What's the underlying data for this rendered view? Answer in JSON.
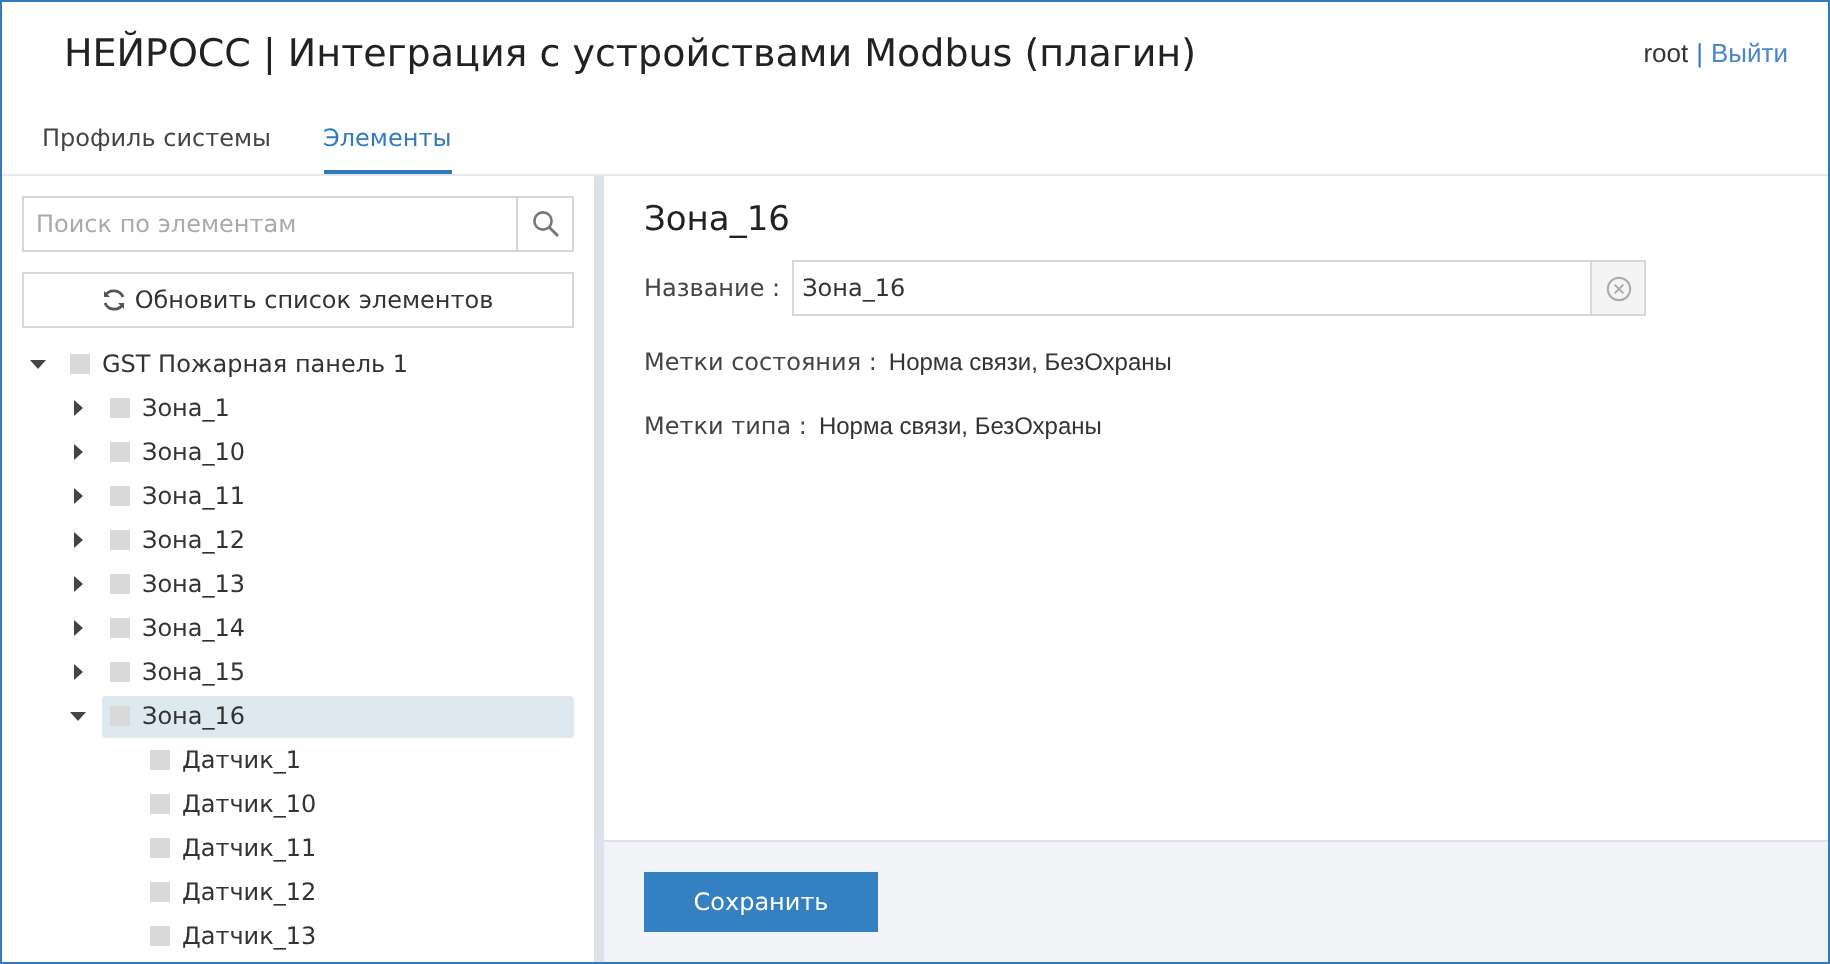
{
  "header": {
    "title": "НЕЙРОСС | Интеграция с устройствами Modbus (плагин)",
    "user": "root",
    "separator": "|",
    "logout": "Выйти"
  },
  "tabs": [
    {
      "label": "Профиль системы",
      "selected": false
    },
    {
      "label": "Элементы",
      "selected": true
    }
  ],
  "sidebar": {
    "search": {
      "placeholder": "Поиск по элементам"
    },
    "refresh_button": "Обновить список элементов",
    "tree": [
      {
        "label": "GST Пожарная панель 1",
        "expanded": true,
        "selected": false,
        "children": [
          {
            "label": "Зона_1",
            "expanded": false,
            "selected": false
          },
          {
            "label": "Зона_10",
            "expanded": false,
            "selected": false
          },
          {
            "label": "Зона_11",
            "expanded": false,
            "selected": false
          },
          {
            "label": "Зона_12",
            "expanded": false,
            "selected": false
          },
          {
            "label": "Зона_13",
            "expanded": false,
            "selected": false
          },
          {
            "label": "Зона_14",
            "expanded": false,
            "selected": false
          },
          {
            "label": "Зона_15",
            "expanded": false,
            "selected": false
          },
          {
            "label": "Зона_16",
            "expanded": true,
            "selected": true,
            "children": [
              {
                "label": "Датчик_1",
                "selected": false
              },
              {
                "label": "Датчик_10",
                "selected": false
              },
              {
                "label": "Датчик_11",
                "selected": false
              },
              {
                "label": "Датчик_12",
                "selected": false
              },
              {
                "label": "Датчик_13",
                "selected": false
              }
            ]
          }
        ]
      }
    ]
  },
  "detail": {
    "heading": "Зона_16",
    "name_label": "Название :",
    "name_value": "Зона_16",
    "properties": [
      {
        "label": "Метки состояния :",
        "value": "Норма связи, БезОхраны"
      },
      {
        "label": "Метки типа :",
        "value": "Норма связи, БезОхраны"
      }
    ],
    "save_button": "Сохранить"
  }
}
